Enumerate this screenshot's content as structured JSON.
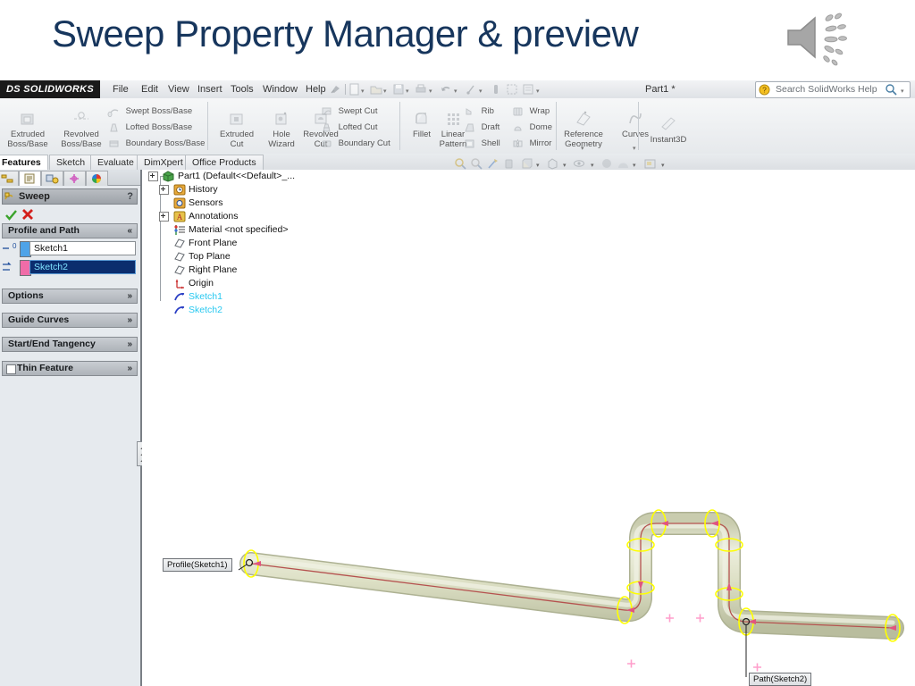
{
  "slide": {
    "title": "Sweep Property Manager & preview",
    "title_color": "#17365d",
    "speaker_icon": "speaker-sound-icon"
  },
  "app": {
    "brand": "DS SOLIDWORKS",
    "document_title": "Part1 *",
    "menu": [
      "File",
      "Edit",
      "View",
      "Insert",
      "Tools",
      "Window",
      "Help"
    ],
    "quick_access_icons": [
      "pin-icon",
      "new-document-icon",
      "open-icon",
      "save-icon",
      "print-icon",
      "undo-icon",
      "rebuild-icon",
      "options-icon",
      "select-icon",
      "edit-appearance-icon"
    ],
    "search": {
      "placeholder": "Search SolidWorks Help",
      "help-icon": "question-help-icon",
      "mag-icon": "magnifier-icon"
    }
  },
  "ribbon": {
    "groups": [
      {
        "big": [
          {
            "label": "Extruded\nBoss/Base",
            "icon": "extruded-boss-icon"
          },
          {
            "label": "Revolved\nBoss/Base",
            "icon": "revolved-boss-icon"
          }
        ],
        "small": [
          {
            "label": "Swept Boss/Base",
            "icon": "swept-boss-icon"
          },
          {
            "label": "Lofted Boss/Base",
            "icon": "lofted-boss-icon"
          },
          {
            "label": "Boundary Boss/Base",
            "icon": "boundary-boss-icon"
          }
        ]
      },
      {
        "big": [
          {
            "label": "Extruded\nCut",
            "icon": "extruded-cut-icon"
          },
          {
            "label": "Hole\nWizard",
            "icon": "hole-wizard-icon"
          },
          {
            "label": "Revolved\nCut",
            "icon": "revolved-cut-icon"
          }
        ],
        "small": [
          {
            "label": "Swept Cut",
            "icon": "swept-cut-icon"
          },
          {
            "label": "Lofted Cut",
            "icon": "lofted-cut-icon"
          },
          {
            "label": "Boundary Cut",
            "icon": "boundary-cut-icon"
          }
        ]
      },
      {
        "big": [
          {
            "label": "Fillet",
            "icon": "fillet-icon"
          },
          {
            "label": "Linear\nPattern",
            "icon": "linear-pattern-icon"
          }
        ],
        "small": [
          {
            "label": "Rib",
            "icon": "rib-icon"
          },
          {
            "label": "Draft",
            "icon": "draft-icon"
          },
          {
            "label": "Shell",
            "icon": "shell-icon"
          },
          {
            "label": "Wrap",
            "icon": "wrap-icon"
          },
          {
            "label": "Dome",
            "icon": "dome-icon"
          },
          {
            "label": "Mirror",
            "icon": "mirror-icon"
          }
        ]
      },
      {
        "big": [
          {
            "label": "Reference\nGeometry",
            "icon": "reference-geometry-icon"
          },
          {
            "label": "Curves",
            "icon": "curves-icon"
          }
        ],
        "small": []
      },
      {
        "big": [
          {
            "label": "Instant3D",
            "icon": "instant3d-icon"
          }
        ],
        "small": []
      }
    ]
  },
  "tabs": [
    {
      "label": "Features",
      "active": true
    },
    {
      "label": "Sketch",
      "active": false
    },
    {
      "label": "Evaluate",
      "active": false
    },
    {
      "label": "DimXpert",
      "active": false
    },
    {
      "label": "Office Products",
      "active": false
    }
  ],
  "view_toolbar": [
    {
      "icon": "zoom-to-fit-icon"
    },
    {
      "icon": "zoom-to-area-icon"
    },
    {
      "icon": "section-view-icon"
    },
    {
      "icon": "view-orientation-icon"
    },
    {
      "icon": "display-style-icon"
    },
    {
      "icon": "hide-show-items-icon"
    },
    {
      "icon": "edit-appearance-icon"
    },
    {
      "icon": "apply-scene-icon"
    },
    {
      "icon": "view-settings-icon"
    }
  ],
  "property_manager": {
    "tabs": [
      {
        "name": "feature-manager-tree-tab",
        "active": false
      },
      {
        "name": "property-manager-tab",
        "active": true
      },
      {
        "name": "configuration-manager-tab",
        "active": false
      },
      {
        "name": "dimxpert-manager-tab",
        "active": false
      },
      {
        "name": "display-manager-tab",
        "active": false
      }
    ],
    "title": "Sweep",
    "help_label": "?",
    "ok_icon": "green-check-icon",
    "cancel_icon": "red-x-icon",
    "sections": [
      {
        "label": "Profile and Path",
        "expanded": true,
        "chev": "«"
      },
      {
        "label": "Options",
        "expanded": false,
        "chev": "»"
      },
      {
        "label": "Guide Curves",
        "expanded": false,
        "chev": "»"
      },
      {
        "label": "Start/End Tangency",
        "expanded": false,
        "chev": "»"
      },
      {
        "label": "Thin Feature",
        "expanded": false,
        "chev": "»",
        "checkbox": true
      }
    ],
    "fields": [
      {
        "name": "profile-field",
        "value": "Sketch1",
        "swatch": "#4ea3e8",
        "icon": "profile-sketch-icon",
        "selected": false
      },
      {
        "name": "path-field",
        "value": "Sketch2",
        "swatch": "#f06ca8",
        "icon": "path-sketch-icon",
        "selected": true
      }
    ]
  },
  "feature_tree": [
    {
      "label": "Part1  (Default<<Default>_...",
      "icon": "part-icon",
      "expander": "minus",
      "indent": 0
    },
    {
      "label": "History",
      "icon": "history-icon",
      "expander": "plus",
      "indent": 1
    },
    {
      "label": "Sensors",
      "icon": "sensors-icon",
      "expander": "none",
      "indent": 1
    },
    {
      "label": "Annotations",
      "icon": "annotations-icon",
      "expander": "plus",
      "indent": 1
    },
    {
      "label": "Material <not specified>",
      "icon": "material-icon",
      "expander": "none",
      "indent": 1
    },
    {
      "label": "Front Plane",
      "icon": "plane-icon",
      "expander": "none",
      "indent": 1
    },
    {
      "label": "Top Plane",
      "icon": "plane-icon",
      "expander": "none",
      "indent": 1
    },
    {
      "label": "Right Plane",
      "icon": "plane-icon",
      "expander": "none",
      "indent": 1
    },
    {
      "label": "Origin",
      "icon": "origin-icon",
      "expander": "none",
      "indent": 1
    },
    {
      "label": "Sketch1",
      "icon": "sketch-icon",
      "expander": "none",
      "indent": 1,
      "style": "sketch"
    },
    {
      "label": "Sketch2",
      "icon": "sketch-icon",
      "expander": "none",
      "indent": 1,
      "style": "sketch"
    }
  ],
  "graphics": {
    "profile_callout": "Profile(Sketch1)",
    "path_callout": "Path(Sketch2)",
    "tube_color": "#d9dcc0",
    "section_marker_color": "#ffff00",
    "centerline_color": "#c0504d",
    "cross_marker_color": "#ff9ecb"
  }
}
